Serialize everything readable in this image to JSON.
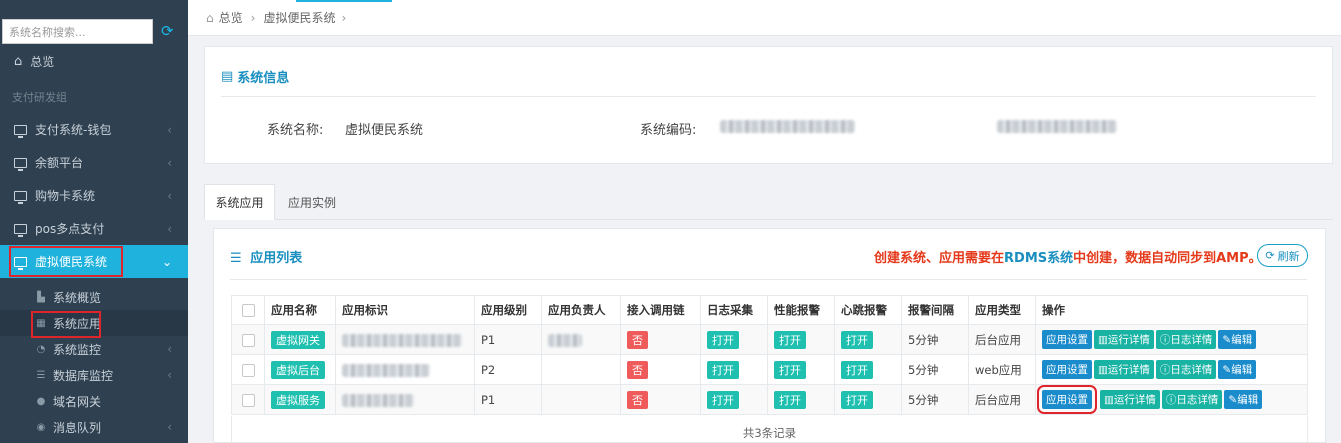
{
  "sidebar": {
    "search_placeholder": "系统名称搜索...",
    "home": "总览",
    "group": "支付研发组",
    "items": [
      {
        "label": "支付系统-钱包"
      },
      {
        "label": "余额平台"
      },
      {
        "label": "购物卡系统"
      },
      {
        "label": "pos多点支付"
      },
      {
        "label": "虚拟便民系统"
      }
    ],
    "subitems": [
      {
        "label": "系统概览"
      },
      {
        "label": "系统应用"
      },
      {
        "label": "系统监控"
      },
      {
        "label": "数据库监控"
      },
      {
        "label": "域名网关"
      },
      {
        "label": "消息队列"
      }
    ]
  },
  "breadcrumb": {
    "home": "总览",
    "current": "虚拟便民系统",
    "sep": "›"
  },
  "system_info": {
    "title": "系统信息",
    "name_label": "系统名称:",
    "name_value": "虚拟便民系统",
    "code_label": "系统编码:"
  },
  "tabs": [
    {
      "label": "系统应用"
    },
    {
      "label": "应用实例"
    }
  ],
  "app_list": {
    "title": "应用列表",
    "notice_pre": "创建系统、应用需要在",
    "notice_hl": "RDMS系统",
    "notice_post": "中创建，数据自动同步到AMP。",
    "refresh_label": "刷新",
    "columns": [
      "应用名称",
      "应用标识",
      "应用级别",
      "应用负责人",
      "接入调用链",
      "日志采集",
      "性能报警",
      "心跳报警",
      "报警间隔",
      "应用类型",
      "操作"
    ],
    "rows": [
      {
        "name": "虚拟网关",
        "level": "P1",
        "trace": "否",
        "log": "打开",
        "perf": "打开",
        "heartbeat": "打开",
        "interval": "5分钟",
        "type": "后台应用"
      },
      {
        "name": "虚拟后台",
        "level": "P2",
        "trace": "否",
        "log": "打开",
        "perf": "打开",
        "heartbeat": "打开",
        "interval": "5分钟",
        "type": "web应用"
      },
      {
        "name": "虚拟服务",
        "level": "P1",
        "trace": "否",
        "log": "打开",
        "perf": "打开",
        "heartbeat": "打开",
        "interval": "5分钟",
        "type": "后台应用"
      }
    ],
    "actions": {
      "settings": "应用设置",
      "run": "运行详情",
      "log": "日志详情",
      "edit": "编辑"
    },
    "footer": "共3条记录"
  },
  "colors": {
    "sidebar_bg": "#2f4050",
    "accent": "#1fb2dd",
    "tag_teal": "#1fc0b0",
    "tag_red": "#ef5b5b",
    "button_blue": "#1a8ccc",
    "highlight_red": "#e0242b"
  }
}
